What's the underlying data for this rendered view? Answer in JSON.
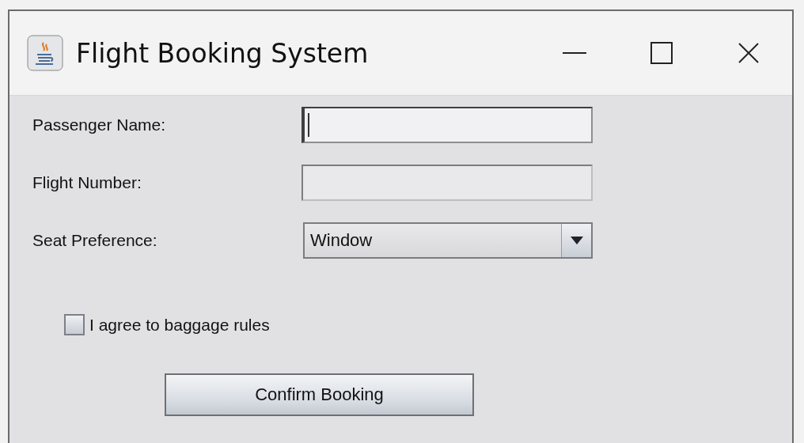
{
  "window": {
    "title": "Flight Booking System"
  },
  "fields": [
    {
      "label": "Passenger Name:",
      "kind": "text",
      "focused": true
    },
    {
      "label": "Flight Number:",
      "kind": "text",
      "focused": false
    },
    {
      "label": "Seat Preference:",
      "kind": "select",
      "value": "Window"
    }
  ],
  "agreement": {
    "label": "I agree to baggage rules",
    "checked": false
  },
  "confirm_button": {
    "label": "Confirm Booking"
  }
}
